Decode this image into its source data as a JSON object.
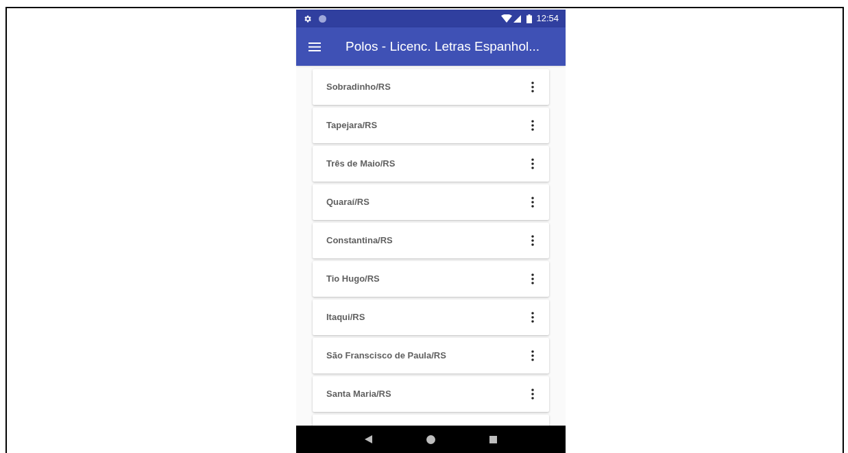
{
  "status_bar": {
    "time": "12:54"
  },
  "app_bar": {
    "title": "Polos - Licenc. Letras Espanhol..."
  },
  "items": [
    {
      "label": "Sobradinho/RS"
    },
    {
      "label": "Tapejara/RS"
    },
    {
      "label": "Três de Maio/RS"
    },
    {
      "label": "Quaraí/RS"
    },
    {
      "label": "Constantina/RS"
    },
    {
      "label": "Tio Hugo/RS"
    },
    {
      "label": "Itaqui/RS"
    },
    {
      "label": "São Franscisco de Paula/RS"
    },
    {
      "label": "Santa Maria/RS"
    }
  ]
}
